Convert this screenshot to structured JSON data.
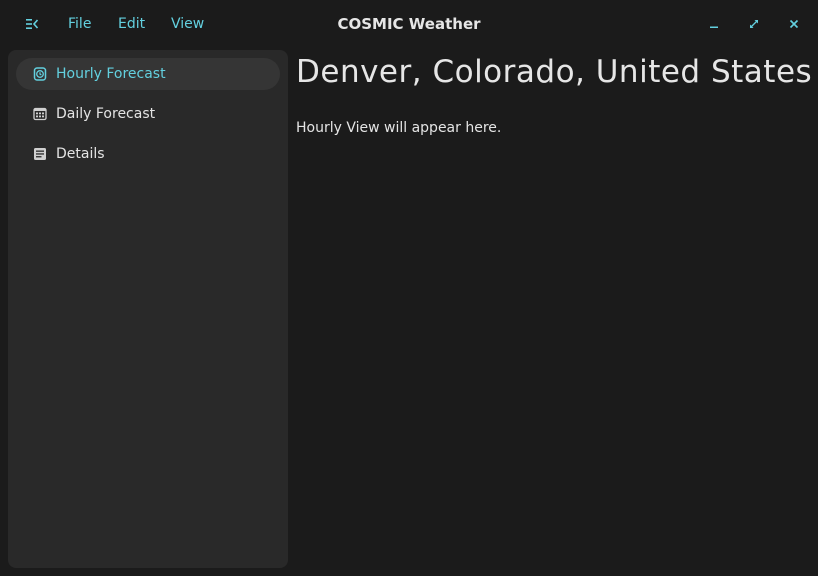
{
  "window": {
    "title": "COSMIC Weather"
  },
  "menubar": {
    "items": [
      {
        "label": "File"
      },
      {
        "label": "Edit"
      },
      {
        "label": "View"
      }
    ]
  },
  "sidebar": {
    "items": [
      {
        "label": "Hourly Forecast",
        "icon": "clock-icon",
        "active": true
      },
      {
        "label": "Daily Forecast",
        "icon": "calendar-icon",
        "active": false
      },
      {
        "label": "Details",
        "icon": "details-list-icon",
        "active": false
      }
    ]
  },
  "main": {
    "location": "Denver, Colorado, United States",
    "placeholder": "Hourly View will appear here."
  },
  "colors": {
    "accent": "#63d0df",
    "background": "#1b1b1b",
    "sidebar_bg": "#292929",
    "active_item_bg": "#353535",
    "text": "#e4e4e4"
  }
}
